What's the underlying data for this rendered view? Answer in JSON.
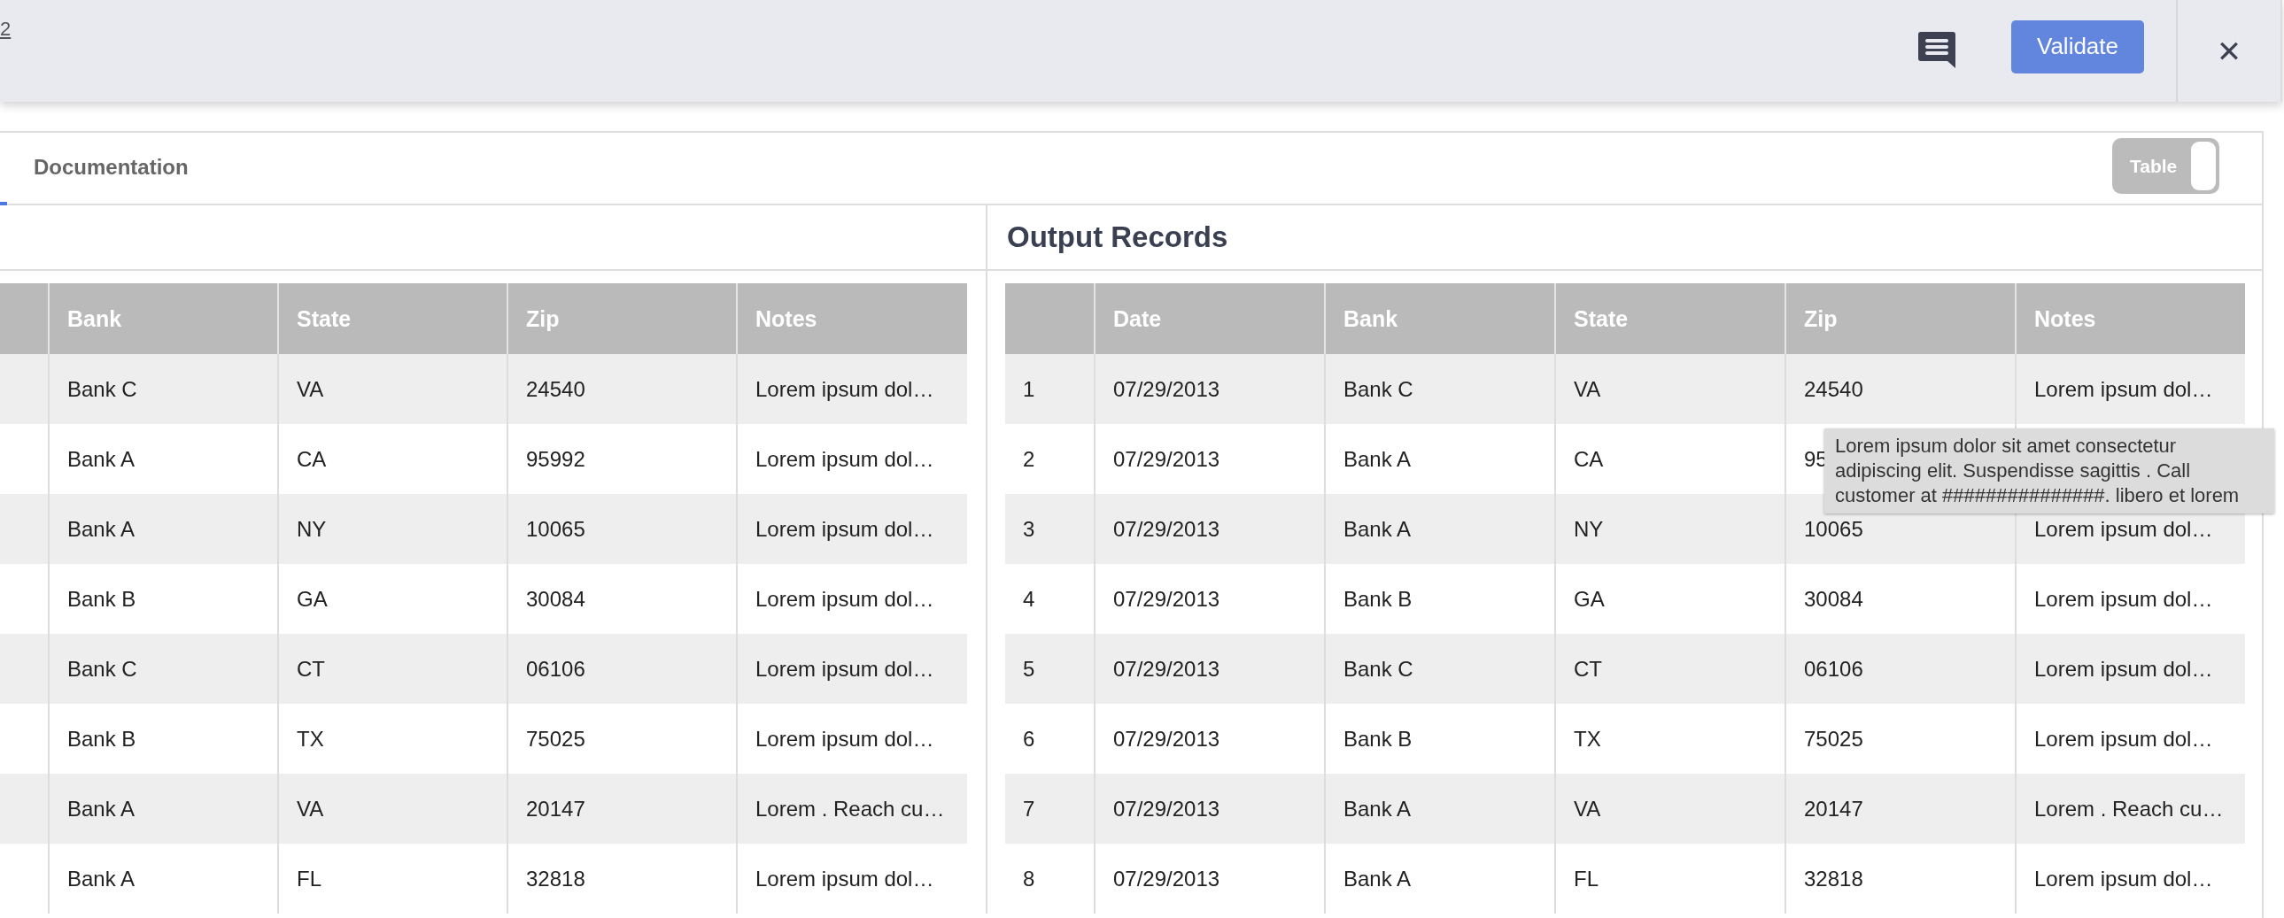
{
  "header": {
    "link_fragment": "2",
    "validate_button": "Validate",
    "close_button": "✕"
  },
  "tabs": [
    {
      "selected": true
    },
    {
      "label": "Documentation",
      "selected": false
    }
  ],
  "view_toggle": {
    "label": "Table",
    "on": false
  },
  "input_pane": {
    "columns": [
      "",
      "Bank",
      "State",
      "Zip",
      "Notes"
    ],
    "rows": [
      [
        "",
        "Bank C",
        "VA",
        "24540",
        "Lorem ipsum dol…"
      ],
      [
        "",
        "Bank A",
        "CA",
        "95992",
        "Lorem ipsum dol…"
      ],
      [
        "",
        "Bank A",
        "NY",
        "10065",
        "Lorem ipsum dol…"
      ],
      [
        "",
        "Bank B",
        "GA",
        "30084",
        "Lorem ipsum dol…"
      ],
      [
        "",
        "Bank C",
        "CT",
        "06106",
        "Lorem ipsum dol…"
      ],
      [
        "",
        "Bank B",
        "TX",
        "75025",
        "Lorem ipsum dol…"
      ],
      [
        "",
        "Bank A",
        "VA",
        "20147",
        "Lorem . Reach cu…"
      ],
      [
        "",
        "Bank A",
        "FL",
        "32818",
        "Lorem ipsum dol…"
      ]
    ]
  },
  "output_pane": {
    "title": "Output Records",
    "columns": [
      "",
      "Date",
      "Bank",
      "State",
      "Zip",
      "Notes"
    ],
    "rows": [
      [
        "1",
        "07/29/2013",
        "Bank C",
        "VA",
        "24540",
        "Lorem ipsum dol…"
      ],
      [
        "2",
        "07/29/2013",
        "Bank A",
        "CA",
        "95"
      ],
      [
        "3",
        "07/29/2013",
        "Bank A",
        "NY",
        "10065",
        "Lorem ipsum dol…"
      ],
      [
        "4",
        "07/29/2013",
        "Bank B",
        "GA",
        "30084",
        "Lorem ipsum dol…"
      ],
      [
        "5",
        "07/29/2013",
        "Bank C",
        "CT",
        "06106",
        "Lorem ipsum dol…"
      ],
      [
        "6",
        "07/29/2013",
        "Bank B",
        "TX",
        "75025",
        "Lorem ipsum dol…"
      ],
      [
        "7",
        "07/29/2013",
        "Bank A",
        "VA",
        "20147",
        "Lorem . Reach cu…"
      ],
      [
        "8",
        "07/29/2013",
        "Bank A",
        "FL",
        "32818",
        "Lorem ipsum dol…"
      ]
    ]
  },
  "tooltip": "Lorem ipsum dolor sit amet consectetur adipiscing elit. Suspendisse sagittis . Call customer at ###############. libero et lorem"
}
